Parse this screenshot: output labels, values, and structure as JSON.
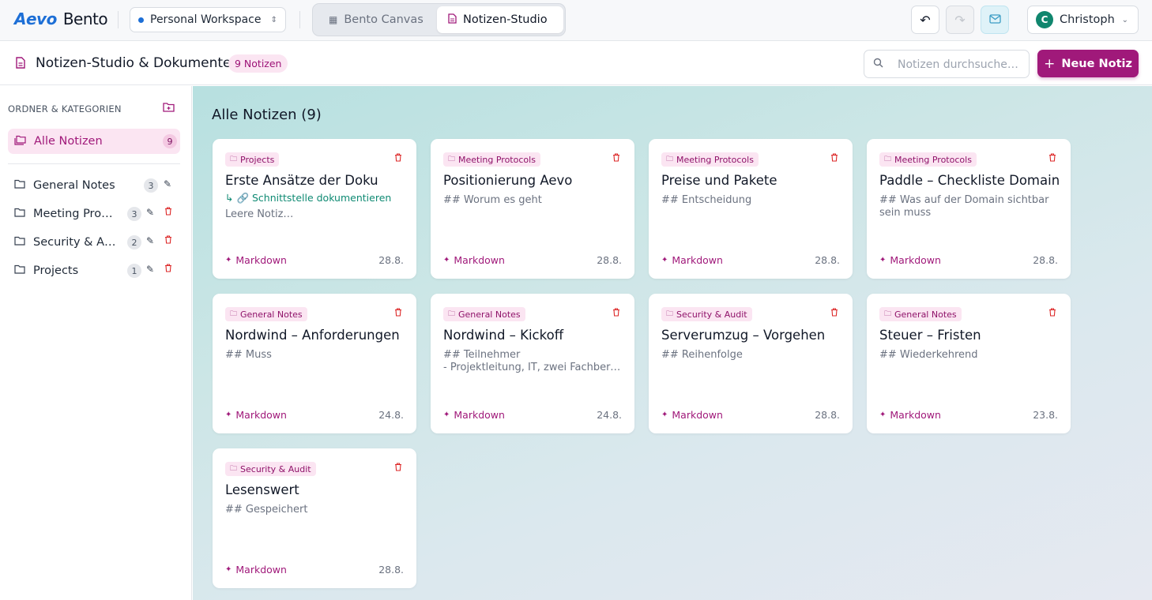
{
  "topbar": {
    "logo_brand": "Aevo",
    "logo_app": "Bento",
    "workspace": "Personal Workspace",
    "tabs": [
      {
        "label": "Bento Canvas",
        "active": false
      },
      {
        "label": "Notizen-Studio",
        "active": true
      }
    ],
    "user": {
      "initial": "C",
      "name": "Christoph"
    }
  },
  "header": {
    "title": "Notizen-Studio & Dokumente",
    "count_badge": "9 Notizen",
    "search_placeholder": "Notizen durchsuche…",
    "new_note_label": "Neue Notiz"
  },
  "sidebar": {
    "heading": "ORDNER & KATEGORIEN",
    "all": {
      "label": "Alle Notizen",
      "count": "9"
    },
    "folders": [
      {
        "label": "General Notes",
        "count": "3",
        "deletable": false
      },
      {
        "label": "Meeting Protocols",
        "count": "3",
        "deletable": true
      },
      {
        "label": "Security & Audit",
        "count": "2",
        "deletable": true
      },
      {
        "label": "Projects",
        "count": "1",
        "deletable": true
      }
    ]
  },
  "main": {
    "title": "Alle Notizen (9)",
    "notes": [
      {
        "category": "Projects",
        "title": "Erste Ansätze der Doku",
        "link": "↳ 🔗 Schnittstelle dokumentieren",
        "preview": [
          "Leere Notiz…"
        ],
        "format": "Markdown",
        "date": "28.8."
      },
      {
        "category": "Meeting Protocols",
        "title": "Positionierung Aevo",
        "link": "",
        "preview": [
          "## Worum es geht"
        ],
        "format": "Markdown",
        "date": "28.8."
      },
      {
        "category": "Meeting Protocols",
        "title": "Preise und Pakete",
        "link": "",
        "preview": [
          "## Entscheidung"
        ],
        "format": "Markdown",
        "date": "28.8."
      },
      {
        "category": "Meeting Protocols",
        "title": "Paddle – Checkliste Domain",
        "link": "",
        "preview": [
          "## Was auf der Domain sichtbar",
          "sein muss"
        ],
        "format": "Markdown",
        "date": "28.8."
      },
      {
        "category": "General Notes",
        "title": "Nordwind – Anforderungen",
        "link": "",
        "preview": [
          "## Muss"
        ],
        "format": "Markdown",
        "date": "24.8."
      },
      {
        "category": "General Notes",
        "title": "Nordwind – Kickoff",
        "link": "",
        "preview": [
          "## Teilnehmer",
          "- Projektleitung, IT, zwei Fachbereiche"
        ],
        "format": "Markdown",
        "date": "24.8."
      },
      {
        "category": "Security & Audit",
        "title": "Serverumzug – Vorgehen",
        "link": "",
        "preview": [
          "## Reihenfolge"
        ],
        "format": "Markdown",
        "date": "28.8."
      },
      {
        "category": "General Notes",
        "title": "Steuer – Fristen",
        "link": "",
        "preview": [
          "## Wiederkehrend"
        ],
        "format": "Markdown",
        "date": "23.8."
      },
      {
        "category": "Security & Audit",
        "title": "Lesenswert",
        "link": "",
        "preview": [
          "## Gespeichert"
        ],
        "format": "Markdown",
        "date": "28.8."
      }
    ]
  },
  "colors": {
    "accent": "#a0197a",
    "accent_soft": "#fbe5f2",
    "link": "#0f8a73",
    "danger": "#dc2626",
    "logo_blue": "#1d6fd6"
  }
}
